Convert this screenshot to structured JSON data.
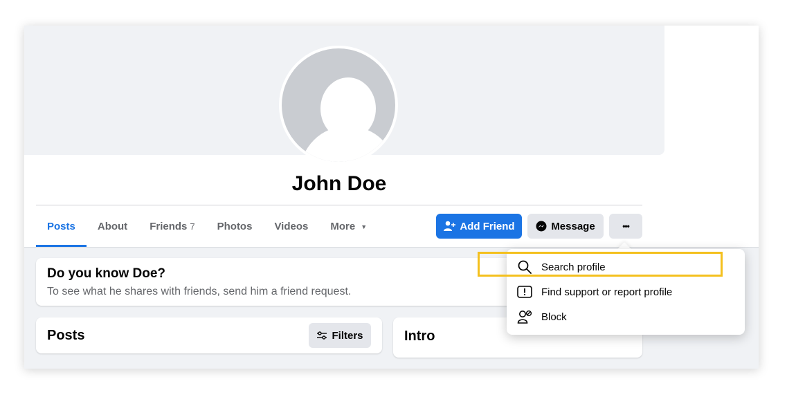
{
  "profile": {
    "name": "John Doe"
  },
  "tabs": [
    {
      "label": "Posts"
    },
    {
      "label": "About"
    },
    {
      "label": "Friends",
      "count": "7"
    },
    {
      "label": "Photos"
    },
    {
      "label": "Videos"
    },
    {
      "label": "More"
    }
  ],
  "actions": {
    "add_friend": "Add Friend",
    "message": "Message",
    "more": "•••"
  },
  "know_card": {
    "title": "Do you know Doe?",
    "subtitle": "To see what he shares with friends, send him a friend request."
  },
  "posts_card": {
    "title": "Posts",
    "filters": "Filters"
  },
  "intro_card": {
    "title": "Intro"
  },
  "menu": {
    "items": [
      {
        "label": "Search profile",
        "icon": "search-icon"
      },
      {
        "label": "Find support or report profile",
        "icon": "report-icon"
      },
      {
        "label": "Block",
        "icon": "block-user-icon"
      }
    ],
    "highlighted_index": 1
  },
  "colors": {
    "accent": "#1b74e4",
    "highlight": "#f4c01e",
    "background": "#f0f2f5"
  }
}
